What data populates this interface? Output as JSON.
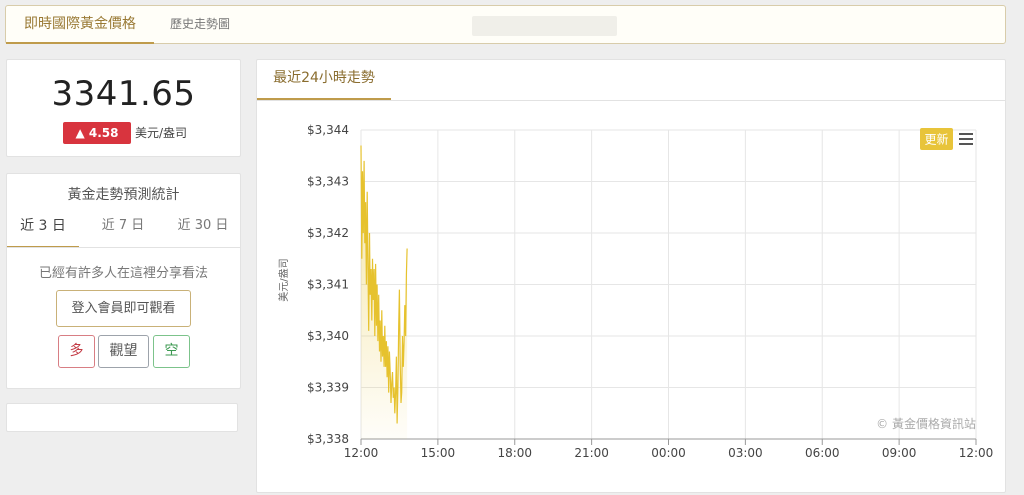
{
  "nav": {
    "tabs": [
      {
        "label": "即時國際黃金價格",
        "active": true
      },
      {
        "label": "歷史走勢圖",
        "active": false
      }
    ]
  },
  "quote": {
    "price": "3341.65",
    "change": "▲ 4.58",
    "unit": "美元/盎司",
    "change_color": "#d8343e"
  },
  "forecast": {
    "title": "黃金走勢預測統計",
    "tabs": [
      "近 3 日",
      "近 7 日",
      "近 30 日"
    ],
    "message": "已經有許多人在這裡分享看法",
    "login_label": "登入會員即可觀看",
    "votes": {
      "bull": "多",
      "hold": "觀望",
      "bear": "空"
    }
  },
  "chart_panel": {
    "tab_label": "最近24小時走勢",
    "refresh_label": "更新",
    "menu_icon": "hamburger-menu-icon"
  },
  "chart_data": {
    "type": "area",
    "ylabel": "美元/盎司",
    "credit": "© 黃金價格資訊站",
    "ylim": [
      3338,
      3344
    ],
    "y_ticks": [
      "$3,344",
      "$3,343",
      "$3,342",
      "$3,341",
      "$3,340",
      "$3,339",
      "$3,338"
    ],
    "x_ticks": [
      "12:00",
      "15:00",
      "18:00",
      "21:00",
      "00:00",
      "03:00",
      "06:00",
      "09:00",
      "12:00"
    ],
    "line_color": "#e6c22e",
    "series": [
      {
        "x": [
          0.0,
          0.03,
          0.06,
          0.09,
          0.12,
          0.15,
          0.18,
          0.21,
          0.24,
          0.27,
          0.3,
          0.33,
          0.36,
          0.39,
          0.42,
          0.45,
          0.48,
          0.51,
          0.54,
          0.57,
          0.6,
          0.63,
          0.66,
          0.69,
          0.72,
          0.75,
          0.78,
          0.81,
          0.84,
          0.87,
          0.9,
          0.93,
          0.96,
          0.99,
          1.02,
          1.05,
          1.08,
          1.11,
          1.14,
          1.17,
          1.2,
          1.23,
          1.26,
          1.29,
          1.32,
          1.35,
          1.38,
          1.41,
          1.44,
          1.47,
          1.5,
          1.53,
          1.56,
          1.59,
          1.62,
          1.65,
          1.68,
          1.71,
          1.74,
          1.77,
          1.8
        ],
        "y": [
          3343.7,
          3341.5,
          3343.2,
          3342.0,
          3343.4,
          3341.8,
          3342.6,
          3341.0,
          3342.8,
          3341.5,
          3340.1,
          3342.0,
          3340.8,
          3341.3,
          3340.3,
          3341.5,
          3340.7,
          3341.3,
          3340.0,
          3341.4,
          3340.2,
          3341.0,
          3339.9,
          3340.8,
          3339.7,
          3340.3,
          3339.5,
          3340.5,
          3339.6,
          3340.0,
          3339.4,
          3340.2,
          3339.4,
          3339.9,
          3339.2,
          3339.8,
          3338.9,
          3339.7,
          3339.3,
          3338.7,
          3339.1,
          3339.3,
          3338.8,
          3339.0,
          3338.5,
          3338.9,
          3339.6,
          3338.3,
          3339.0,
          3340.2,
          3340.9,
          3339.5,
          3338.7,
          3338.9,
          3340.0,
          3339.4,
          3339.9,
          3340.6,
          3340.0,
          3341.2,
          3341.7
        ]
      }
    ]
  }
}
